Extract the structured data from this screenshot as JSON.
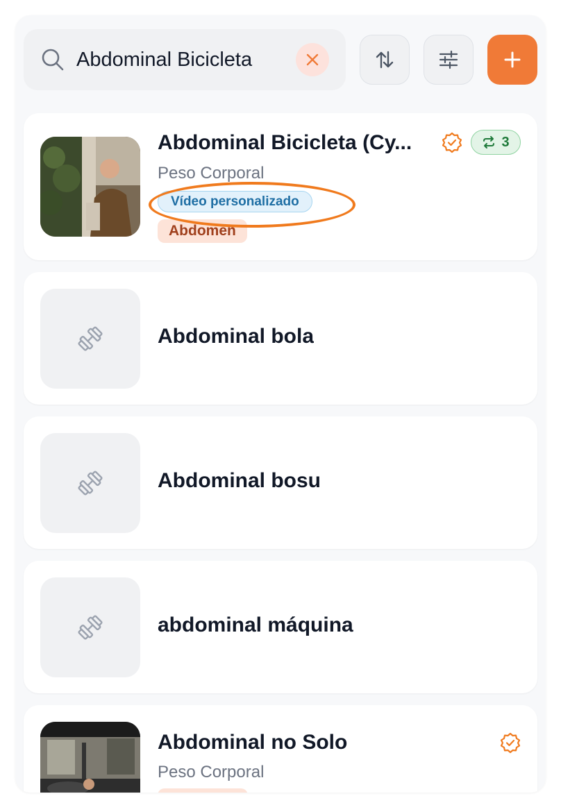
{
  "search": {
    "value": "Abdominal Bicicleta",
    "placeholder": ""
  },
  "toolbar": {
    "sort_icon": "sort-arrows-icon",
    "filter_icon": "sliders-icon",
    "add_icon": "plus-icon"
  },
  "colors": {
    "accent": "#f07a37",
    "verified": "#f07a1d",
    "repeat_badge_text": "#1f7a3a",
    "video_badge_text": "#1e6ea4",
    "muscle_tag_text": "#a0401d"
  },
  "exercises": [
    {
      "title": "Abdominal Bicicleta (Cy...",
      "equipment": "Peso Corporal",
      "video_badge": "Vídeo personalizado",
      "muscle_tag": "Abdomen",
      "repeat_count": "3",
      "thumbnail": "video-frame"
    },
    {
      "title": "Abdominal bola",
      "thumbnail": "dumbbell-icon"
    },
    {
      "title": "Abdominal bosu",
      "thumbnail": "dumbbell-icon"
    },
    {
      "title": "abdominal máquina",
      "thumbnail": "dumbbell-icon"
    },
    {
      "title": "Abdominal no Solo",
      "equipment": "Peso Corporal",
      "thumbnail": "gym-photo"
    }
  ]
}
